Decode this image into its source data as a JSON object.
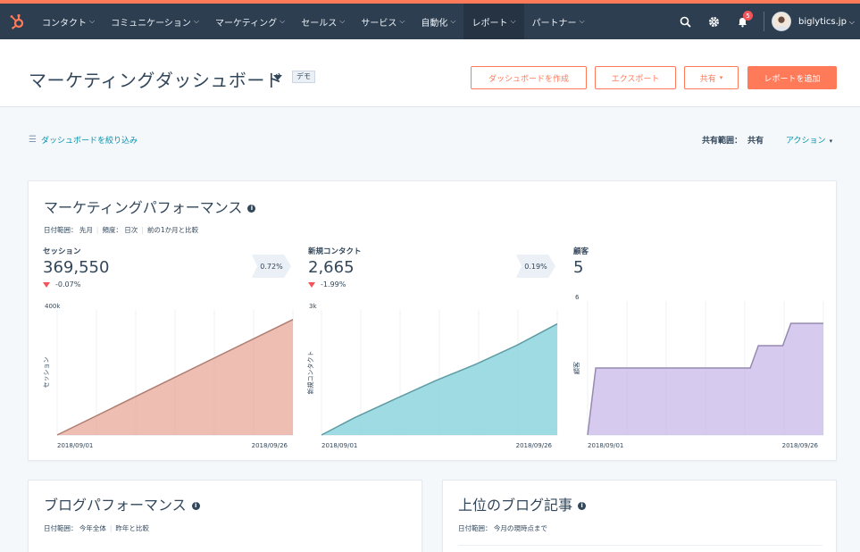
{
  "nav": {
    "items": [
      {
        "label": "コンタクト"
      },
      {
        "label": "コミュニケーション"
      },
      {
        "label": "マーケティング"
      },
      {
        "label": "セールス"
      },
      {
        "label": "サービス"
      },
      {
        "label": "自動化"
      },
      {
        "label": "レポート",
        "active": true
      },
      {
        "label": "パートナー"
      }
    ],
    "notification_count": "5",
    "account": "biglytics.jp",
    "icons": [
      "sprocket-logo-icon",
      "search-icon",
      "gear-icon",
      "bell-icon",
      "avatar"
    ],
    "colors": {
      "bar": "#2d3e50",
      "accent": "#ff7a59"
    }
  },
  "header": {
    "title": "マーケティングダッシュボード",
    "demo_tag": "デモ",
    "buttons": {
      "create": "ダッシュボードを作成",
      "export": "エクスポート",
      "share": "共有",
      "add_report": "レポートを追加"
    }
  },
  "filter": {
    "label": "ダッシュボードを絞り込み",
    "share_scope_label": "共有範囲：",
    "share_scope_value": "共有",
    "action_label": "アクション"
  },
  "marketing_performance": {
    "title": "マーケティングパフォーマンス",
    "meta": {
      "date_range": "日付範囲： 先月",
      "frequency": "頻度： 日次",
      "compare": "前の1か月と比較"
    },
    "kpis": [
      {
        "label": "セッション",
        "value": "369,550",
        "delta": "-0.07%",
        "trend": "down"
      },
      {
        "label": "新規コンタクト",
        "value": "2,665",
        "delta": "-1.99%",
        "trend": "down"
      },
      {
        "label": "顧客",
        "value": "5"
      }
    ],
    "conversions": [
      "0.72%",
      "0.19%"
    ]
  },
  "chart_data": [
    {
      "type": "area",
      "ylabel": "セッション",
      "y_tick_top": "400k",
      "x_tick_labels": [
        "2018/09/01",
        "2018/09/26"
      ],
      "ylim": [
        0,
        400000
      ],
      "x": [
        "2018/09/01",
        "2018/09/30"
      ],
      "values": [
        0,
        369550
      ],
      "color": "#e8a899",
      "grid": true
    },
    {
      "type": "area",
      "ylabel": "新規コンタクト",
      "y_tick_top": "3k",
      "x_tick_labels": [
        "2018/09/01",
        "2018/09/26"
      ],
      "ylim": [
        0,
        3000
      ],
      "x": [
        "2018/09/01",
        "2018/09/05",
        "2018/09/10",
        "2018/09/15",
        "2018/09/20",
        "2018/09/25",
        "2018/09/30"
      ],
      "values": [
        0,
        410,
        860,
        1300,
        1700,
        2150,
        2665
      ],
      "color": "#7fcfd8",
      "grid": true
    },
    {
      "type": "area",
      "ylabel": "顧客",
      "y_tick_top": "6",
      "x_tick_labels": [
        "2018/09/01",
        "2018/09/26"
      ],
      "ylim": [
        0,
        6
      ],
      "x": [
        "2018/09/01",
        "2018/09/02",
        "2018/09/03",
        "2018/09/21",
        "2018/09/22",
        "2018/09/25",
        "2018/09/26",
        "2018/09/30"
      ],
      "values": [
        0,
        3,
        3,
        3,
        4,
        4,
        5,
        5
      ],
      "color": "#c8b8ea",
      "grid": true
    }
  ],
  "blog_performance": {
    "title": "ブログパフォーマンス",
    "meta": {
      "date_range": "日付範囲： 今年全体",
      "compare": "昨年と比較"
    }
  },
  "top_blog_posts": {
    "title": "上位のブログ記事",
    "meta": {
      "date_range": "日付範囲： 今月の現時点まで"
    }
  }
}
